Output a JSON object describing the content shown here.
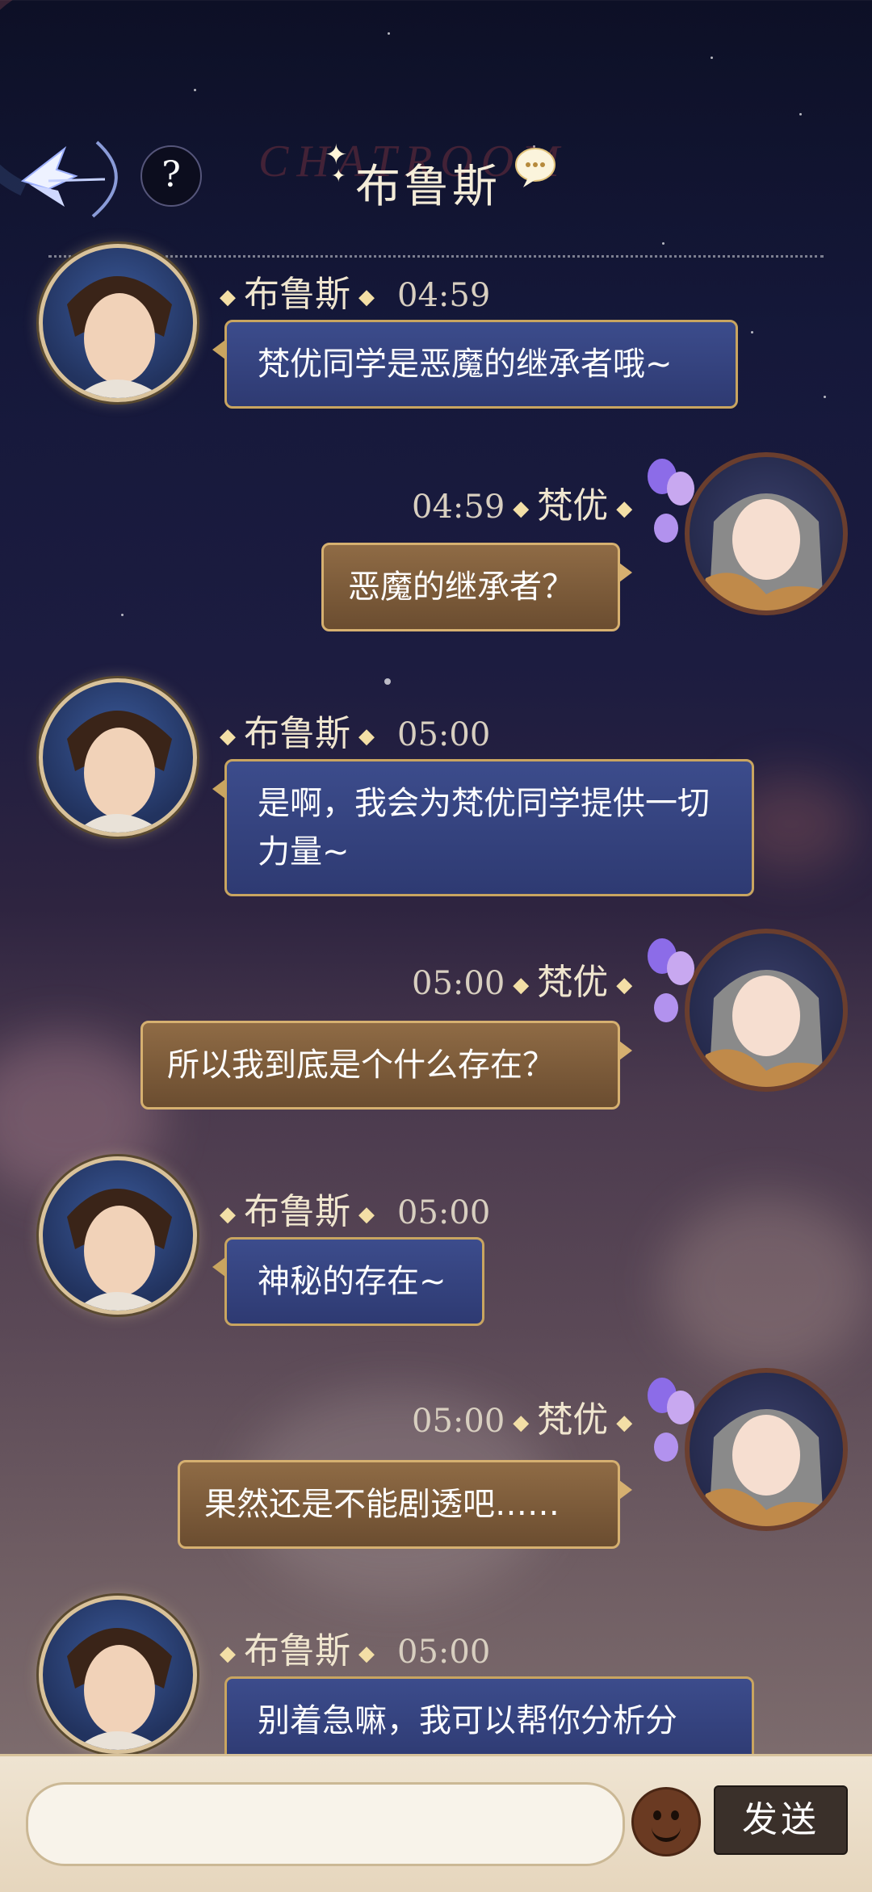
{
  "header": {
    "title": "布鲁斯",
    "watermark": "CHATROOM",
    "help_label": "?",
    "back_icon": "back-arrow-icon",
    "chat_icon": "chat-bubble-icon"
  },
  "messages": [
    {
      "sender": "布鲁斯",
      "time": "04:59",
      "text": "梵优同学是恶魔的继承者哦~",
      "side": "left"
    },
    {
      "sender": "梵优",
      "time": "04:59",
      "text": "恶魔的继承者？",
      "side": "right"
    },
    {
      "sender": "布鲁斯",
      "time": "05:00",
      "text": "是啊，我会为梵优同学提供一切力量~",
      "side": "left"
    },
    {
      "sender": "梵优",
      "time": "05:00",
      "text": "所以我到底是个什么存在？",
      "side": "right"
    },
    {
      "sender": "布鲁斯",
      "time": "05:00",
      "text": "神秘的存在~",
      "side": "left"
    },
    {
      "sender": "梵优",
      "time": "05:00",
      "text": "果然还是不能剧透吧……",
      "side": "right"
    },
    {
      "sender": "布鲁斯",
      "time": "05:00",
      "text": "别着急嘛，我可以帮你分析分",
      "side": "left"
    }
  ],
  "input": {
    "value": "",
    "emoji_icon": "smiley-emoji-icon",
    "send_label": "发送"
  },
  "colors": {
    "bubble_left": "#2e3a72",
    "bubble_right": "#7a5a3a",
    "border_gold": "#c9a560",
    "send_button": "#3a302a"
  }
}
